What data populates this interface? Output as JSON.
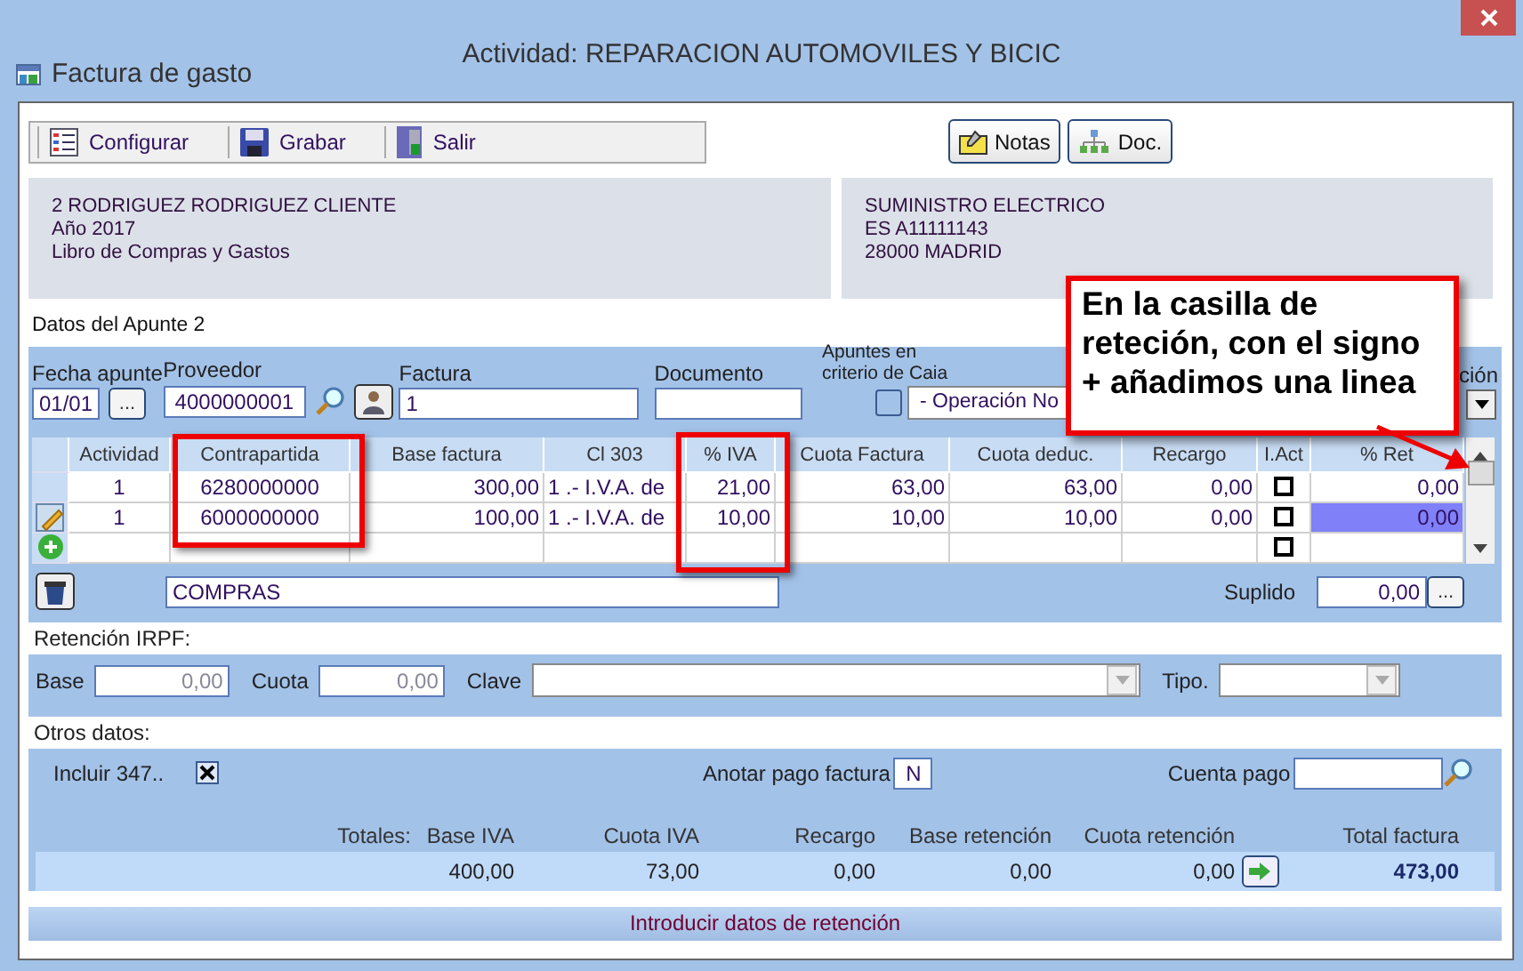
{
  "window": {
    "title": "Actividad: REPARACION AUTOMOVILES Y BICIC",
    "form_title": "Factura de gasto"
  },
  "toolbar": [
    {
      "kind": "config",
      "label": "Configurar"
    },
    {
      "kind": "save",
      "label": "Grabar"
    },
    {
      "kind": "exit",
      "label": "Salir"
    }
  ],
  "side_buttons": [
    {
      "kind": "notes",
      "label": "Notas"
    },
    {
      "kind": "doc",
      "label": "Doc."
    }
  ],
  "client_info": [
    "2 RODRIGUEZ RODRIGUEZ CLIENTE",
    "Año 2017",
    "Libro de Compras y Gastos"
  ],
  "supplier_info": [
    "SUMINISTRO ELECTRICO",
    "ES A11111143",
    "28000 MADRID"
  ],
  "section_title": "Datos del Apunte 2",
  "fields": {
    "fecha_label": "Fecha apunte",
    "fecha": "01/01",
    "browse": "...",
    "proveedor_label": "Proveedor",
    "proveedor": "4000000001",
    "factura_label": "Factura",
    "factura": "1",
    "documento_label": "Documento",
    "caja_label": [
      "Apuntes en",
      "criterio de Caia"
    ],
    "caja_checked": false,
    "operacion": "- Operación No",
    "cut_label": "ción"
  },
  "grid": {
    "columns": [
      "Actividad",
      "Contrapartida",
      "Base factura",
      "Cl 303",
      "% IVA",
      "Cuota Factura",
      "Cuota deduc.",
      "Recargo",
      "I.Act",
      "% Ret"
    ],
    "rows": [
      {
        "kind": "none",
        "cells": [
          "1",
          "6280000000",
          "300,00",
          "1 .- I.V.A. de",
          "21,00",
          "63,00",
          "63,00",
          "0,00"
        ],
        "i_act": false,
        "ret": "0,00",
        "selected": false
      },
      {
        "kind": "edit",
        "cells": [
          "1",
          "6000000000",
          "100,00",
          "1 .- I.V.A. de",
          "10,00",
          "10,00",
          "10,00",
          "0,00"
        ],
        "i_act": false,
        "ret": "0,00",
        "selected": true
      },
      {
        "kind": "new",
        "cells": [
          "",
          "",
          "",
          "",
          "",
          "",
          "",
          ""
        ],
        "i_act": false,
        "ret": "",
        "selected": false
      }
    ]
  },
  "concepto": "COMPRAS",
  "suplido_label": "Suplido",
  "suplido": "0,00",
  "suplido_button": "...",
  "retencion": {
    "title": "Retención IRPF:",
    "base_label": "Base",
    "base": "0,00",
    "cuota_label": "Cuota",
    "cuota": "0,00",
    "clave_label": "Clave",
    "tipo_label": "Tipo."
  },
  "otros": {
    "title": "Otros datos:",
    "incluir_label": "Incluir 347..",
    "incluir_checked": true,
    "anotar_label": "Anotar pago factura",
    "anotar": "N",
    "cuenta_label": "Cuenta pago"
  },
  "totals": {
    "label": "Totales:",
    "columns": [
      {
        "label": "Base IVA",
        "value": "400,00"
      },
      {
        "label": "Cuota IVA",
        "value": "73,00"
      },
      {
        "label": "Recargo",
        "value": "0,00"
      },
      {
        "label": "Base retención",
        "value": "0,00"
      },
      {
        "label": "Cuota retención",
        "value": "0,00"
      }
    ],
    "total_label": "Total factura",
    "total": "473,00"
  },
  "footer_button": "Introducir datos de retención",
  "annotation": "En la casilla de reteción, con el signo + añadimos una linea"
}
